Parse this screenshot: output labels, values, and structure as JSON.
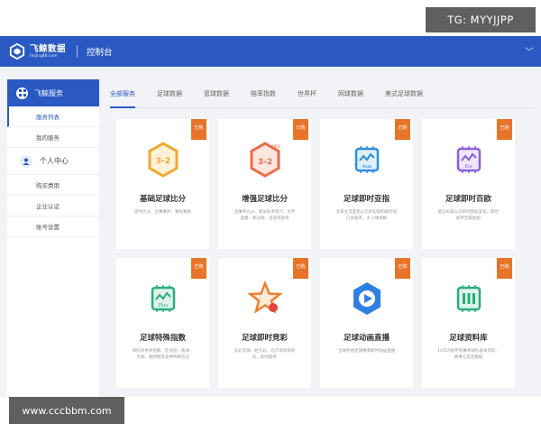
{
  "watermark": {
    "tg": "TG: MYYJJPP",
    "url": "www.cccbbm.com"
  },
  "topbar": {
    "logo_name": "飞鲸数据",
    "logo_domain": "feijing88.com",
    "section_title": "控制台",
    "chevron": "chevron-down-icon"
  },
  "sidebar": {
    "header": "飞鲸服务",
    "service_items": [
      {
        "label": "服务列表",
        "active": true
      },
      {
        "label": "我的服务",
        "active": false
      }
    ],
    "group": "个人中心",
    "account_items": [
      {
        "label": "购买费用"
      },
      {
        "label": "企业认证"
      },
      {
        "label": "账号设置"
      }
    ]
  },
  "tabs": [
    {
      "label": "全部服务",
      "active": true
    },
    {
      "label": "足球数据"
    },
    {
      "label": "篮球数据"
    },
    {
      "label": "赔率指数"
    },
    {
      "label": "世界杯"
    },
    {
      "label": "网球数据"
    },
    {
      "label": "美式足球数据"
    }
  ],
  "ribbon_text": "已购",
  "cards": [
    {
      "title": "基础足球比分",
      "desc": "即时比分、比赛事件、赛程赛果",
      "icon": "hexagon-score-icon",
      "color": "#f0a92e"
    },
    {
      "title": "增强足球比分",
      "desc": "含事件比分、球员技术统计、文字直播、积分榜、首发阵容等",
      "icon": "hexagon-pro-score-icon",
      "color": "#ec6b4a"
    },
    {
      "title": "足球即时亚指",
      "desc": "多家主流亚指公司的初盘和即时盘口及赔率、大小球指数",
      "icon": "chip-asia-icon",
      "color": "#2c8ee0"
    },
    {
      "title": "足球即时百欧",
      "desc": "超100家公司即时欧赔变化，即时赔率百家欧赔",
      "icon": "chip-euro-icon",
      "color": "#8c5fd8"
    },
    {
      "title": "足球特殊指数",
      "desc": "球队的半场指数、走地盘、角球、点球、黄牌数等多种特殊玩法",
      "icon": "chip-plus-icon",
      "color": "#2bab7b"
    },
    {
      "title": "足球即时竞彩",
      "desc": "竞彩足球、胜负彩、北京单场等体彩、即时赔率",
      "icon": "star-ball-icon",
      "color": "#ef8030"
    },
    {
      "title": "足球动画直播",
      "desc": "全球各地足球赛事即时动画直播",
      "icon": "play-cube-icon",
      "color": "#2d7fe3"
    },
    {
      "title": "足球资料库",
      "desc": "10年内的所有赛季球队基本资料、赛事信息及数据",
      "icon": "book-data-icon",
      "color": "#2bab7b"
    }
  ]
}
